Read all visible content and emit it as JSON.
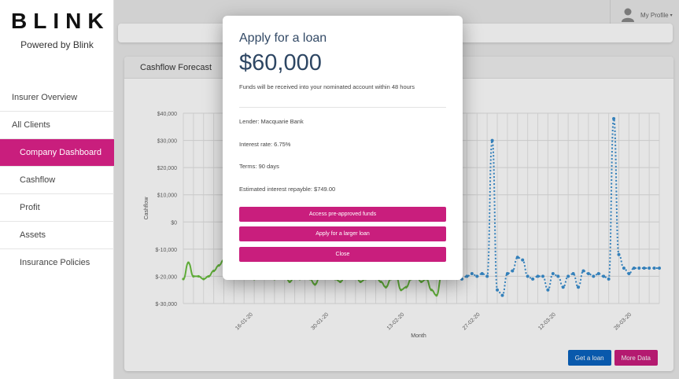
{
  "brand": {
    "logo_text": "BLINK",
    "powered_by": "Powered by Blink",
    "accent": "#c91e7d"
  },
  "sidebar": {
    "items": [
      {
        "label": "Insurer Overview"
      },
      {
        "label": "All Clients"
      },
      {
        "label": "Company Dashboard"
      },
      {
        "label": "Cashflow"
      },
      {
        "label": "Profit"
      },
      {
        "label": "Assets"
      },
      {
        "label": "Insurance Policies"
      }
    ]
  },
  "header": {
    "profile_label": "My Profile",
    "profile_icon": "user-avatar-icon"
  },
  "card": {
    "title": "Cashflow Forecast",
    "buttons": {
      "get_loan": "Get a loan",
      "more_data": "More Data"
    }
  },
  "chart_data": {
    "type": "line",
    "title": "",
    "xlabel": "Month",
    "ylabel": "Cashflow",
    "ylim": [
      -30000,
      40000
    ],
    "yticks": [
      "$40,000",
      "$30,000",
      "$20,000",
      "$10,000",
      "$0",
      "$-10,000",
      "$-20,000",
      "$-30,000"
    ],
    "xticks": [
      "16-01-20",
      "30-01-20",
      "13-02-20",
      "27-02-20",
      "12-03-20",
      "26-03-20"
    ],
    "grid": true,
    "series": [
      {
        "style": "solid",
        "color": "#6abf40",
        "x": [
          0,
          1,
          2,
          3,
          4,
          5,
          6,
          7,
          8,
          9,
          10,
          11,
          12,
          13,
          14,
          15,
          16,
          17,
          18,
          19,
          20,
          21,
          22,
          23,
          24,
          25,
          26,
          27,
          28,
          29,
          30,
          31,
          32,
          33,
          34,
          35,
          36,
          37,
          38,
          39,
          40,
          41,
          42,
          43,
          44,
          45,
          46,
          47,
          48,
          49,
          50,
          51,
          52,
          53,
          54,
          55
        ],
        "values": [
          -21000,
          -15000,
          -20000,
          -20000,
          -21000,
          -20000,
          -18000,
          -16000,
          -14000,
          -16000,
          -18000,
          -20000,
          -18000,
          -20000,
          -21000,
          -20000,
          -19000,
          -20000,
          -21000,
          -20000,
          -19000,
          -22000,
          -20000,
          -21000,
          -19000,
          -21000,
          -23000,
          -20000,
          -19000,
          -20000,
          -21000,
          -22000,
          -20000,
          -19000,
          -20000,
          -22000,
          -21000,
          -19000,
          -20000,
          -22000,
          -24000,
          -21000,
          -20000,
          -25000,
          -24000,
          -21000,
          -20000,
          -22000,
          -21000,
          -25000,
          -27000,
          -20000,
          -15000,
          -3000,
          -4000,
          -21000
        ]
      },
      {
        "style": "dotted",
        "color": "#3a8fd0",
        "x": [
          55,
          56,
          57,
          58,
          59,
          60,
          61,
          62,
          63,
          64,
          65,
          66,
          67,
          68,
          69,
          70,
          71,
          72,
          73,
          74,
          75,
          76,
          77,
          78,
          79,
          80,
          81,
          82,
          83,
          84,
          85,
          86,
          87,
          88,
          89,
          90,
          91,
          92,
          93,
          94
        ],
        "values": [
          -21000,
          -20000,
          -19000,
          -20000,
          -19000,
          -20000,
          30000,
          -25000,
          -27000,
          -19000,
          -18000,
          -13000,
          -14000,
          -20000,
          -21000,
          -20000,
          -20000,
          -25000,
          -19000,
          -20000,
          -24000,
          -20000,
          -19000,
          -24000,
          -18000,
          -19000,
          -20000,
          -19000,
          -20000,
          -21000,
          38000,
          -12000,
          -17000,
          -19000,
          -17000,
          -17000,
          -17000,
          -17000,
          -17000,
          -17000
        ]
      }
    ]
  },
  "modal": {
    "title": "Apply for a loan",
    "amount": "$60,000",
    "description": "Funds will be received into your nominated account within 48 hours",
    "lender": "Lender: Macquarie Bank",
    "interest_rate": "Interest rate: 6.75%",
    "terms": "Terms: 90 days",
    "interest_repayable": "Estimated interest repayble: $749.00",
    "buttons": {
      "access": "Access pre-approved funds",
      "larger": "Apply for a larger loan",
      "close": "Close"
    }
  }
}
